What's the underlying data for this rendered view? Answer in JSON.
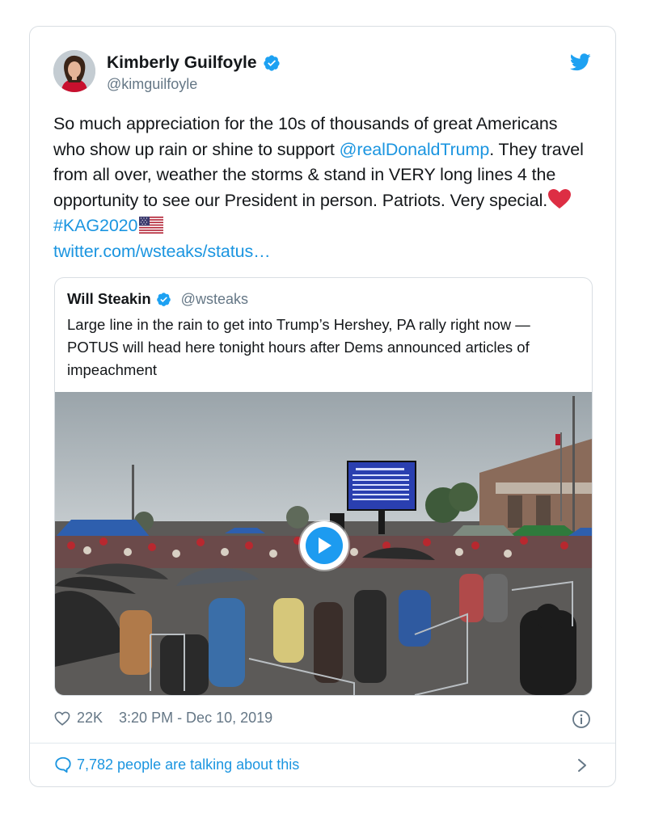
{
  "author": {
    "name": "Kimberly Guilfoyle",
    "handle": "@kimguilfoyle",
    "verified": true,
    "avatar_icon": "profile-photo"
  },
  "tweet": {
    "text_parts": [
      "So much appreciation for the 10s of thousands of great Americans who show up rain or shine to support ",
      "@realDonaldTrump",
      ". They travel from all over, weather the storms & stand in VERY long lines 4 the opportunity to see our President in person. Patriots. Very special.",
      "#KAG2020",
      "twitter.com/wsteaks/status…"
    ],
    "emoji": [
      "red-heart",
      "us-flag"
    ]
  },
  "quoted": {
    "name": "Will Steakin",
    "handle": "@wsteaks",
    "verified": true,
    "text": "Large line in the rain to get into Trump’s Hershey, PA rally right now — POTUS will head here tonight hours after Dems announced articles of impeachment",
    "media": {
      "type": "video",
      "icon": "play-icon"
    }
  },
  "meta": {
    "likes": "22K",
    "timestamp": "3:20 PM - Dec 10, 2019"
  },
  "footer": {
    "talking": "7,782 people are talking about this"
  },
  "colors": {
    "link": "#1b95e0",
    "verified": "#1da1f2",
    "secondary_text": "#657786",
    "border": "#d9dee3"
  }
}
